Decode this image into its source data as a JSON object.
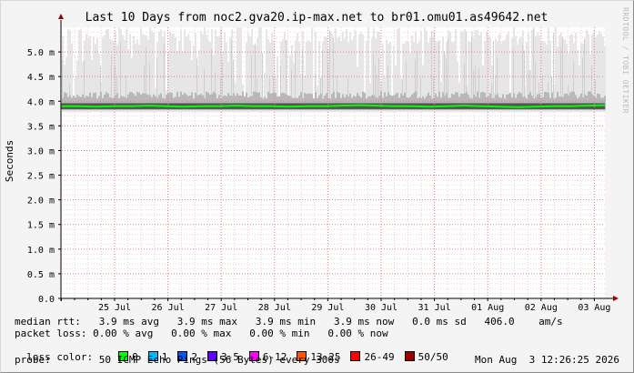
{
  "chart_data": {
    "type": "line",
    "title": "Last 10 Days from noc2.gva20.ip-max.net to br01.omu01.as49642.net",
    "ylabel": "Seconds",
    "watermark": "RRDTOOL / TOBI OETIKER",
    "ylim": [
      0,
      5.5
    ],
    "y_ticks": [
      {
        "value": 0.0,
        "label": "0.0"
      },
      {
        "value": 0.5,
        "label": "0.5 m"
      },
      {
        "value": 1.0,
        "label": "1.0 m"
      },
      {
        "value": 1.5,
        "label": "1.5 m"
      },
      {
        "value": 2.0,
        "label": "2.0 m"
      },
      {
        "value": 2.5,
        "label": "2.5 m"
      },
      {
        "value": 3.0,
        "label": "3.0 m"
      },
      {
        "value": 3.5,
        "label": "3.5 m"
      },
      {
        "value": 4.0,
        "label": "4.0 m"
      },
      {
        "value": 4.5,
        "label": "4.5 m"
      },
      {
        "value": 5.0,
        "label": "5.0 m"
      }
    ],
    "x_ticks": [
      "25 Jul",
      "26 Jul",
      "27 Jul",
      "28 Jul",
      "29 Jul",
      "30 Jul",
      "31 Jul",
      "01 Aug",
      "02 Aug",
      "03 Aug"
    ],
    "series": [
      {
        "name": "median rtt",
        "color": "#00ff00",
        "values": [
          3.9,
          3.9,
          3.89,
          3.9,
          3.9,
          3.91,
          3.9,
          3.89,
          3.9,
          3.9,
          3.91,
          3.9,
          3.9,
          3.89,
          3.9,
          3.9,
          3.91,
          3.92,
          3.91,
          3.9,
          3.9,
          3.89,
          3.9,
          3.91,
          3.9,
          3.89,
          3.88,
          3.89,
          3.9,
          3.9,
          3.91,
          3.92
        ]
      }
    ],
    "smoke_range": {
      "min": 3.78,
      "max": 5.5
    }
  },
  "stats": {
    "median_rtt": "median rtt:   3.9 ms avg   3.9 ms max   3.9 ms min   3.9 ms now   0.0 ms sd   406.0    am/s",
    "packet_loss": "packet loss: 0.00 % avg   0.00 % max   0.00 % min   0.00 % now",
    "loss_color_label": "loss color:",
    "loss_colors": [
      {
        "label": "0",
        "color": "#00ff00"
      },
      {
        "label": "1",
        "color": "#00b8ff"
      },
      {
        "label": "2",
        "color": "#0059ff"
      },
      {
        "label": "3-5",
        "color": "#5e00ff"
      },
      {
        "label": "6-12",
        "color": "#ff00ff"
      },
      {
        "label": "13-25",
        "color": "#ff5500"
      },
      {
        "label": "26-49",
        "color": "#ff0000"
      },
      {
        "label": "50/50",
        "color": "#a10000"
      }
    ],
    "probe": "probe:        50 ICMP Echo Pings (56 Bytes) every 300s",
    "timestamp": "Mon Aug  3 12:26:25 2026"
  }
}
